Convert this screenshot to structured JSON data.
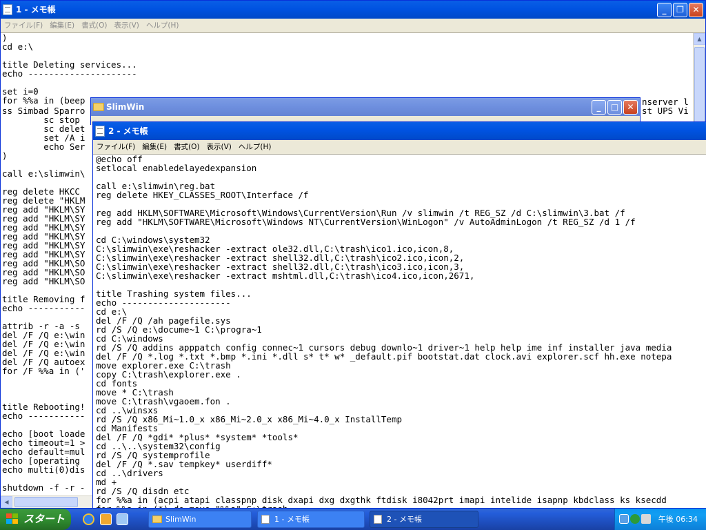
{
  "window1": {
    "title": "1 - メモ帳",
    "menu": [
      "ファイル(F)",
      "編集(E)",
      "書式(O)",
      "表示(V)",
      "ヘルプ(H)"
    ],
    "text": ")\ncd e:\\\n\ntitle Deleting services...\necho ---------------------\n\nset i=0\nfor %%a in (beep",
    "text_hidden": "ss Simbad Sparro\n        sc stop\n        sc delet\n        set /A i\n        echo Ser\n)\n\ncall e:\\slimwin\\\n\nreg delete HKCC\nreg delete \"HKLM\nreg add \"HKLM\\SY\nreg add \"HKLM\\SY\nreg add \"HKLM\\SY\nreg add \"HKLM\\SY\nreg add \"HKLM\\SY\nreg add \"HKLM\\SY\nreg add \"HKLM\\SO\nreg add \"HKLM\\SO\nreg add \"HKLM\\SO\n\ntitle Removing f\necho -----------\n\nattrib -r -a -s\ndel /F /Q e:\\win\ndel /F /Q e:\\win\ndel /F /Q e:\\win\ndel /F /Q autoex\nfor /F %%a in ('\n\n\n\ntitle Rebooting!\necho -----------\n\necho [boot loade\necho timeout=1 >\necho default=mul\necho [operating\necho multi(0)dis\n\nshutdown -f -r -",
    "right_fragments": [
      "nserver l",
      "st UPS Vi"
    ]
  },
  "window_slimwin": {
    "title": "SlimWin"
  },
  "window2": {
    "title": "2 - メモ帳",
    "menu": [
      "ファイル(F)",
      "編集(E)",
      "書式(O)",
      "表示(V)",
      "ヘルプ(H)"
    ],
    "text": "@echo off\nsetlocal enabledelayedexpansion\n\ncall e:\\slimwin\\reg.bat\nreg delete HKEY_CLASSES_ROOT\\Interface /f\n\nreg add HKLM\\SOFTWARE\\Microsoft\\Windows\\CurrentVersion\\Run /v slimwin /t REG_SZ /d C:\\slimwin\\3.bat /f\nreg add \"HKLM\\SOFTWARE\\Microsoft\\Windows NT\\CurrentVersion\\WinLogon\" /v AutoAdminLogon /t REG_SZ /d 1 /f\n\ncd C:\\windows\\system32\nC:\\slimwin\\exe\\reshacker -extract ole32.dll,C:\\trash\\ico1.ico,icon,8,\nC:\\slimwin\\exe\\reshacker -extract shell32.dll,C:\\trash\\ico2.ico,icon,2,\nC:\\slimwin\\exe\\reshacker -extract shell32.dll,C:\\trash\\ico3.ico,icon,3,\nC:\\slimwin\\exe\\reshacker -extract mshtml.dll,C:\\trash\\ico4.ico,icon,2671,\n\ntitle Trashing system files...\necho ---------------------\ncd e:\\\ndel /F /Q /ah pagefile.sys\nrd /S /Q e:\\docume~1 C:\\progra~1\ncd C:\\windows\nrd /S /Q addins apppatch config connec~1 cursors debug downlo~1 driver~1 help help ime inf installer java media\ndel /F /Q *.log *.txt *.bmp *.ini *.dll s* t* w* _default.pif bootstat.dat clock.avi explorer.scf hh.exe notepa\nmove explorer.exe C:\\trash\ncopy C:\\trash\\explorer.exe .\ncd fonts\nmove * C:\\trash\nmove C:\\trash\\vgaoem.fon .\ncd ..\\winsxs\nrd /S /Q x86_Mi~1.0_x x86_Mi~2.0_x x86_Mi~4.0_x InstallTemp\ncd Manifests\ndel /F /Q *gdi* *plus* *system* *tools*\ncd ..\\..\\system32\\config\nrd /S /Q systemprofile\ndel /F /Q *.sav tempkey* userdiff*\ncd ..\\drivers\nmd +\nrd /S /Q disdn etc\nfor %%a in (acpi atapi classpnp disk dxapi dxg dxgthk ftdisk i8042prt imapi intelide isapnp kbdclass ks ksecdd\nfor %%a in (*) do move \"%%a\" C:\\trash"
  },
  "taskbar": {
    "start_label": "スタート",
    "tasks": [
      "SlimWin",
      "1 - メモ帳",
      "2 - メモ帳"
    ],
    "clock": "午後 06:34"
  },
  "colors": {
    "titlebar": "#0054e3",
    "desktop": "#3a6ea5",
    "taskbar": "#245edb",
    "start": "#3c9a3c",
    "tray": "#0c97f0"
  }
}
